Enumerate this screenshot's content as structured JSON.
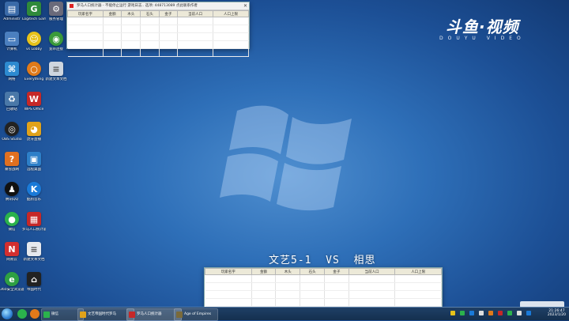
{
  "desktop": {
    "icons": [
      {
        "label": "Administr",
        "color": "#3a6aa8"
      },
      {
        "label": "Logitech Gaming",
        "color": "#2f8a3a"
      },
      {
        "label": "服务管理",
        "color": "#6a6a7a"
      },
      {
        "label": "计算机",
        "color": "#4b7fbf"
      },
      {
        "label": "vs Lobby",
        "color": "#e6c21a"
      },
      {
        "label": "宽带连接",
        "color": "#3a9a3a"
      },
      {
        "label": "网络",
        "color": "#2d8ad0"
      },
      {
        "label": "Everything",
        "color": "#e07a1a"
      },
      {
        "label": "新建文本文档",
        "color": "#cfd6df"
      },
      {
        "label": "回收站",
        "color": "#4a78a8"
      },
      {
        "label": "WPS Office",
        "color": "#c62828"
      },
      {
        "label": "OBS Studio",
        "color": "#222222"
      },
      {
        "label": "虎牙直播",
        "color": "#e0a21a"
      },
      {
        "label": "暴雪战网",
        "color": "#e07020"
      },
      {
        "label": "远程桌面",
        "color": "#2d7fc8"
      },
      {
        "label": "腾讯QQ",
        "color": "#111111"
      },
      {
        "label": "酷狗音乐",
        "color": "#1a7ad8"
      },
      {
        "label": "微信",
        "color": "#2bb24c"
      },
      {
        "label": "罗马人口统计器",
        "color": "#c62828"
      },
      {
        "label": "网易云",
        "color": "#d32f2f"
      },
      {
        "label": "新建文本文档",
        "color": "#e6e9ee"
      },
      {
        "label": "360安全浏览器",
        "color": "#2ea043"
      },
      {
        "label": "帝国时代",
        "color": "#222222"
      }
    ]
  },
  "brand": {
    "main": "斗鱼·视频",
    "sub": "DOUYU VIDEO"
  },
  "match": {
    "text": "文艺5-1  VS  相思"
  },
  "top_window": {
    "title": "罗马人口统计器 - 不能停止运行 游戏日志.. 选项: 448713089 点此联系作者",
    "columns": [
      "玩家名字",
      "金额",
      "木头",
      "石头",
      "金子",
      "当前人口",
      "人口上限"
    ]
  },
  "bottom_window": {
    "columns": [
      "玩家名字",
      "金额",
      "木头",
      "石头",
      "金子",
      "当前人口",
      "人口上限"
    ]
  },
  "taskbar": {
    "buttons": [
      {
        "label": "微信",
        "color": "#2bb24c"
      },
      {
        "label": "文艺帝国时代罗马",
        "color": "#e0a21a"
      },
      {
        "label": "罗马人口统计器",
        "color": "#c62828"
      },
      {
        "label": "Age of Empires",
        "color": "#7a6a3a"
      }
    ],
    "time": "21:26:47",
    "date": "2023/1/20"
  }
}
